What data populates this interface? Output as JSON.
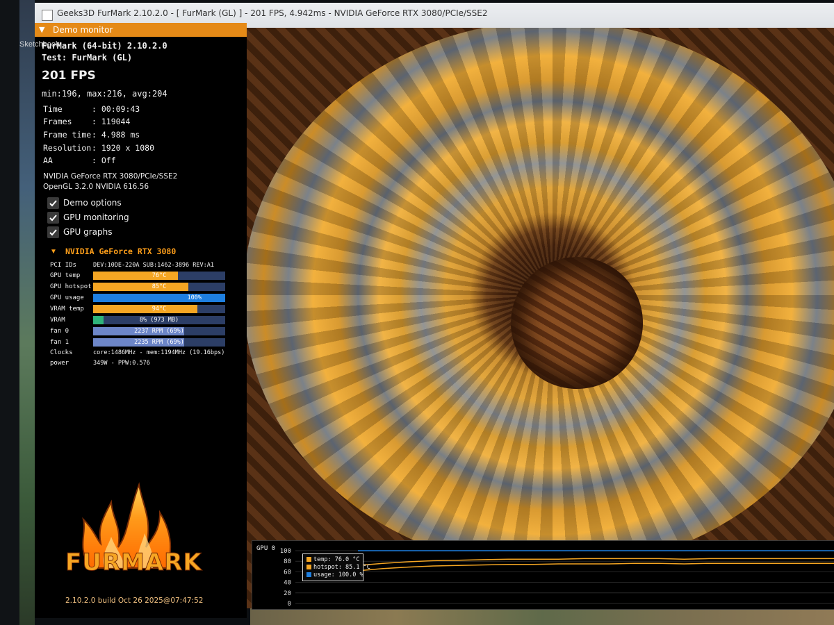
{
  "window": {
    "title": "Geeks3D FurMark 2.10.2.0 - [ FurMark (GL) ] - 201 FPS, 4.942ms - NVIDIA GeForce RTX 3080/PCIe/SSE2"
  },
  "desktop": {
    "icon_label": "Sketchbook"
  },
  "demo_monitor": {
    "header": "Demo monitor",
    "app": "FurMark (64-bit) 2.10.2.0",
    "test": "Test: FurMark (GL)",
    "fps": "201 FPS",
    "fps_stats": "min:196, max:216, avg:204",
    "stats": [
      {
        "key": "Time",
        "value": ": 00:09:43"
      },
      {
        "key": "Frames",
        "value": ": 119044"
      },
      {
        "key": "Frame time",
        "value": ": 4.988 ms"
      },
      {
        "key": "Resolution",
        "value": ": 1920 x 1080"
      },
      {
        "key": "AA",
        "value": ": Off"
      }
    ],
    "renderer": "NVIDIA GeForce RTX 3080/PCIe/SSE2",
    "opengl": "OpenGL 3.2.0 NVIDIA 616.56",
    "options": [
      {
        "label": "Demo options",
        "checked": true
      },
      {
        "label": "GPU monitoring",
        "checked": true
      },
      {
        "label": "GPU graphs",
        "checked": true
      }
    ]
  },
  "gpu": {
    "name": "NVIDIA GeForce RTX 3080",
    "pci_label": "PCI IDs",
    "pci_value": "DEV:10DE-220A SUB:1462-3896 REV:A1",
    "bars": [
      {
        "label": "GPU temp",
        "text": "76°C",
        "fraction": 0.64,
        "color": "#f5a623"
      },
      {
        "label": "GPU hotspot",
        "text": "85°C",
        "fraction": 0.72,
        "color": "#f5a623"
      },
      {
        "label": "GPU usage",
        "text": "100%",
        "fraction": 1.0,
        "color": "#1e7fe0"
      },
      {
        "label": "VRAM temp",
        "text": "94°C",
        "fraction": 0.79,
        "color": "#f5a623"
      },
      {
        "label": "VRAM",
        "text": "8% (973 MB)",
        "fraction": 0.08,
        "color": "#2fb37a"
      },
      {
        "label": "fan 0",
        "text": "2237 RPM (69%)",
        "fraction": 0.69,
        "color": "#6d86c8"
      },
      {
        "label": "fan 1",
        "text": "2235 RPM (69%)",
        "fraction": 0.69,
        "color": "#6d86c8"
      }
    ],
    "clocks_label": "Clocks",
    "clocks_value": "core:1486MHz - mem:1194MHz (19.16bps)",
    "power_label": "power",
    "power_value": "349W - PPW:0.576"
  },
  "branding": {
    "logo_text": "FURMARK",
    "build": "2.10.2.0 build Oct 26 2025@07:47:52"
  },
  "graph": {
    "title": "GPU 0",
    "y_ticks": [
      "100",
      "80",
      "60",
      "40",
      "20",
      "0"
    ],
    "legend": [
      {
        "label": "temp: 76.0 °C",
        "color": "#f5a623"
      },
      {
        "label": "hotspot: 85.1 °C",
        "color": "#f5a623"
      },
      {
        "label": "usage: 100.0 %",
        "color": "#1e7fe0"
      }
    ]
  },
  "chart_data": {
    "type": "line",
    "title": "GPU 0",
    "ylim": [
      0,
      100
    ],
    "series": [
      {
        "name": "temp",
        "values": [
          62,
          66,
          69,
          71,
          72,
          73,
          74,
          74,
          75,
          75,
          75,
          76,
          76,
          75,
          76,
          76,
          76,
          76,
          76,
          76
        ]
      },
      {
        "name": "hotspot",
        "values": [
          72,
          76,
          79,
          81,
          82,
          83,
          84,
          84,
          84,
          85,
          85,
          85,
          85,
          84,
          85,
          85,
          85,
          85,
          85,
          85
        ]
      },
      {
        "name": "usage",
        "values": [
          100,
          100,
          100,
          100,
          100,
          100,
          100,
          100,
          100,
          100,
          100,
          100,
          100,
          100,
          100,
          100,
          100,
          100,
          100,
          100
        ]
      }
    ]
  }
}
